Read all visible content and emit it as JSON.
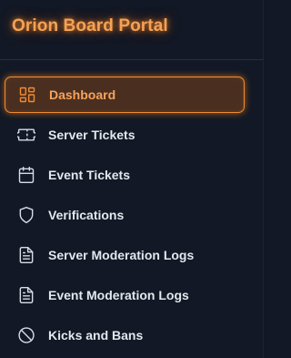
{
  "app": {
    "title": "Orion Board Portal"
  },
  "sidebar": {
    "items": [
      {
        "label": "Dashboard",
        "icon": "dashboard-icon",
        "active": true
      },
      {
        "label": "Server Tickets",
        "icon": "ticket-icon",
        "active": false
      },
      {
        "label": "Event Tickets",
        "icon": "calendar-icon",
        "active": false
      },
      {
        "label": "Verifications",
        "icon": "shield-icon",
        "active": false
      },
      {
        "label": "Server Moderation Logs",
        "icon": "document-icon",
        "active": false
      },
      {
        "label": "Event Moderation Logs",
        "icon": "document-icon",
        "active": false
      },
      {
        "label": "Kicks and Bans",
        "icon": "ban-icon",
        "active": false
      }
    ]
  },
  "colors": {
    "background": "#121825",
    "accent": "#f28b2f",
    "active_bg": "#4a2f21",
    "text": "#e3e7ee"
  }
}
